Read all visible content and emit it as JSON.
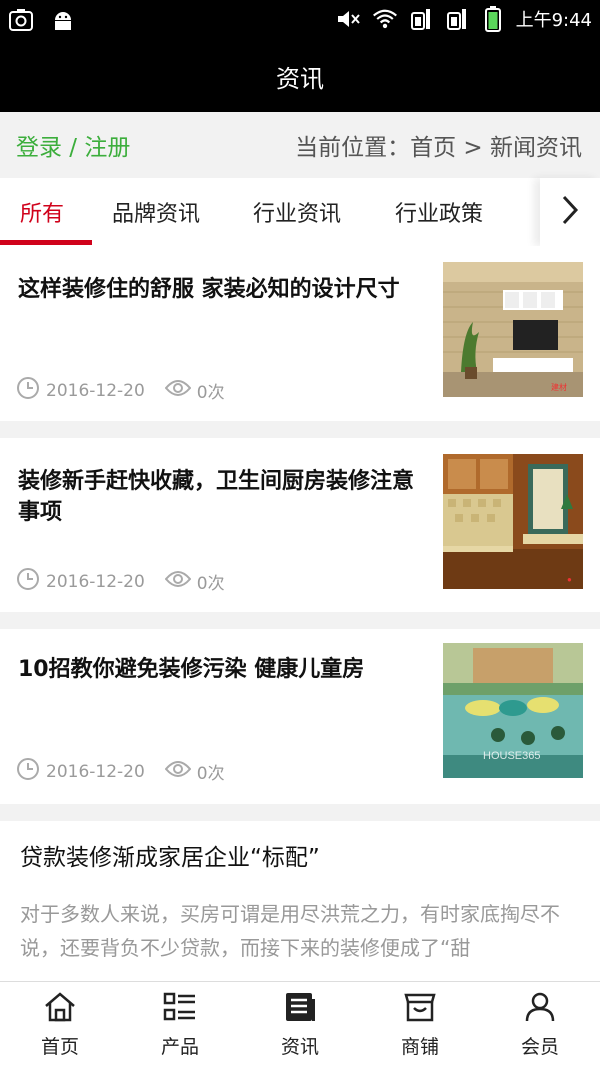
{
  "status_bar": {
    "time": "上午9:44"
  },
  "header": {
    "title": "资讯"
  },
  "location_bar": {
    "login_label": "登录 / 注册",
    "breadcrumb": "当前位置：首页 > 新闻资讯"
  },
  "tabs": [
    {
      "label": "所有"
    },
    {
      "label": "品牌资讯"
    },
    {
      "label": "行业资讯"
    },
    {
      "label": "行业政策"
    }
  ],
  "articles": [
    {
      "title": "这样装修住的舒服 家装必知的设计尺寸",
      "date": "2016-12-20",
      "views": "0次"
    },
    {
      "title": "装修新手赶快收藏，卫生间厨房装修注意事项",
      "date": "2016-12-20",
      "views": "0次"
    },
    {
      "title": "10招教你避免装修污染 健康儿童房",
      "date": "2016-12-20",
      "views": "0次"
    },
    {
      "title": "贷款装修渐成家居企业“标配”",
      "excerpt": "对于多数人来说，买房可谓是用尽洪荒之力，有时家底掏尽不说，还要背负不少贷款，而接下来的装修便成了“甜"
    }
  ],
  "bottom_nav": [
    {
      "label": "首页",
      "icon": "home-icon"
    },
    {
      "label": "产品",
      "icon": "list-icon"
    },
    {
      "label": "资讯",
      "icon": "news-icon"
    },
    {
      "label": "商铺",
      "icon": "store-icon"
    },
    {
      "label": "会员",
      "icon": "user-icon"
    }
  ]
}
